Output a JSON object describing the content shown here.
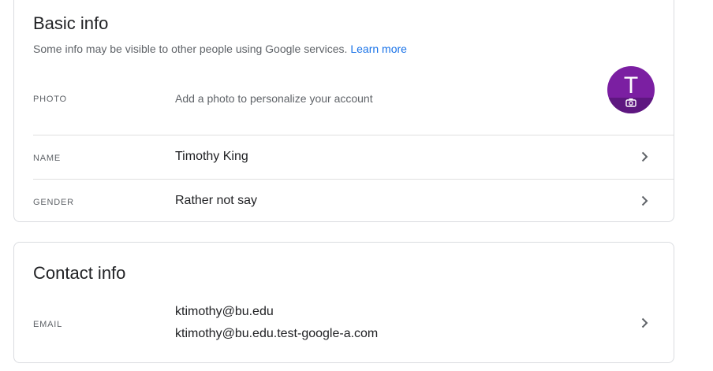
{
  "basic_info": {
    "title": "Basic info",
    "subtitle": "Some info may be visible to other people using Google services.",
    "learn_more": "Learn more",
    "photo": {
      "label": "PHOTO",
      "value": "Add a photo to personalize your account",
      "avatar_letter": "T",
      "avatar_color": "#7b1fa2",
      "overlay_icon": "camera-icon"
    },
    "name": {
      "label": "NAME",
      "value": "Timothy King",
      "icon": "chevron-right-icon"
    },
    "gender": {
      "label": "GENDER",
      "value": "Rather not say",
      "icon": "chevron-right-icon"
    }
  },
  "contact_info": {
    "title": "Contact info",
    "email": {
      "label": "EMAIL",
      "values": [
        "ktimothy@bu.edu",
        "ktimothy@bu.edu.test-google-a.com"
      ],
      "icon": "chevron-right-icon"
    }
  },
  "colors": {
    "link": "#1a73e8",
    "border": "#dadce0",
    "muted_text": "#5f6368"
  }
}
